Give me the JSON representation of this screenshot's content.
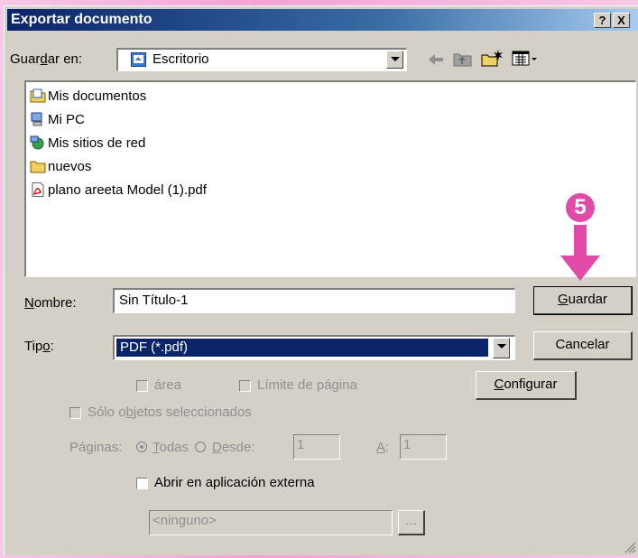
{
  "dialog": {
    "title": "Exportar documento",
    "help_label": "?",
    "close_label": "X"
  },
  "save_in": {
    "label_pre": "Guar",
    "label_key": "d",
    "label_post": "ar en:",
    "value": "Escritorio"
  },
  "toolbar": {
    "back_icon": "back-arrow-icon",
    "up_icon": "up-folder-icon",
    "new_folder_icon": "new-folder-icon",
    "view_icon": "view-menu-icon"
  },
  "files": [
    {
      "name": "Mis documentos",
      "icon": "my-documents-icon"
    },
    {
      "name": "Mi PC",
      "icon": "my-computer-icon"
    },
    {
      "name": "Mis sitios de red",
      "icon": "network-places-icon"
    },
    {
      "name": "nuevos",
      "icon": "folder-icon"
    },
    {
      "name": "plano areeta Model (1).pdf",
      "icon": "pdf-file-icon"
    }
  ],
  "annotation": {
    "step": "5",
    "color": "#e24aa8"
  },
  "name_field": {
    "label_key": "N",
    "label_post": "ombre:",
    "value": "Sin Título-1"
  },
  "type_field": {
    "label_pre": "Tip",
    "label_key": "o",
    "label_post": ":",
    "value": "PDF (*.pdf)"
  },
  "buttons": {
    "save_key": "G",
    "save_post": "uardar",
    "cancel": "Cancelar",
    "configure_key": "C",
    "configure_post": "onfigurar",
    "browse": "..."
  },
  "options": {
    "area": "área",
    "page_limit": "Límite de página",
    "selected_only_pre": "Sólo o",
    "selected_only_key": "b",
    "selected_only_post": "jetos seleccionados",
    "pages_label": "Páginas:",
    "all_key": "T",
    "all_post": "odas",
    "from_key": "D",
    "from_post": "esde:",
    "from_value": "1",
    "to_key": "A",
    "to_post": ":",
    "to_value": "1",
    "open_external": "Abrir en aplicación externa",
    "app_value": "<ninguno>"
  }
}
